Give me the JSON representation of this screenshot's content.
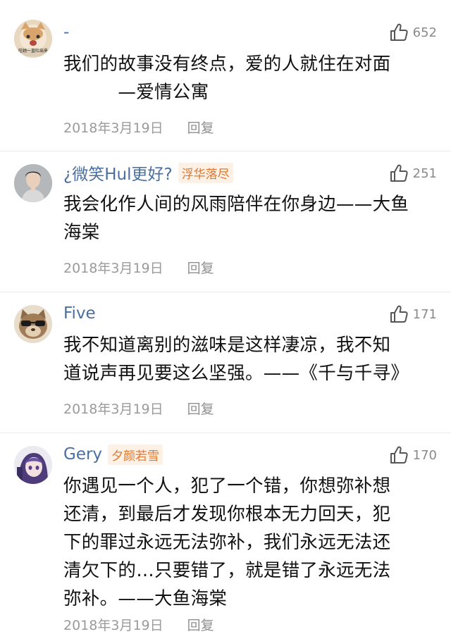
{
  "comments": [
    {
      "username": "-",
      "tag": "",
      "likes": "652",
      "lines": [
        "我们的故事没有终点，爱的人就住在对面",
        "　　　—爱情公寓"
      ],
      "date": "2018年3月19日",
      "reply": "回复",
      "avatar_icon": "cat-avatar-icon",
      "avatar_text": "哇她一直吐出来"
    },
    {
      "username": "¿微笑Hul更好?",
      "tag": "浮华落尽",
      "likes": "251",
      "lines": [
        "我会化作人间的风雨陪伴在你身边——大鱼",
        "海棠"
      ],
      "date": "2018年3月19日",
      "reply": "回复",
      "avatar_icon": "man-avatar-icon"
    },
    {
      "username": "Five",
      "tag": "",
      "likes": "171",
      "lines": [
        "我不知道离别的滋味是这样凄凉，我不知",
        "道说声再见要这么坚强。——《千与千寻》"
      ],
      "date": "2018年3月19日",
      "reply": "回复",
      "avatar_icon": "sunglasses-cat-avatar-icon"
    },
    {
      "username": "Gery",
      "tag": "夕颜若雪",
      "likes": "170",
      "lines": [
        "你遇见一个人，犯了一个错，你想弥补想",
        "还清，到最后才发现你根本无力回天，犯",
        "下的罪过永远无法弥补，我们永远无法还",
        "清欠下的…只要错了，就是错了永远无法",
        "弥补。——大鱼海棠"
      ],
      "date": "2018年3月19日",
      "reply": "回复",
      "avatar_icon": "anime-girl-avatar-icon"
    }
  ],
  "colors": {
    "username": "#4a6f9e",
    "tag_text": "#e0762e",
    "tag_bg": "#fdf1e6",
    "meta": "#9a9a9a"
  }
}
